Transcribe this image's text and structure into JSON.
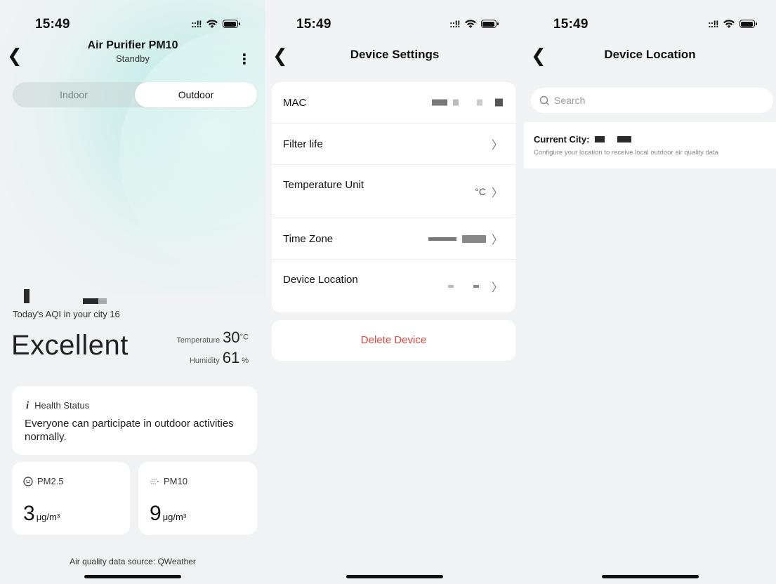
{
  "status": {
    "time": "15:49",
    "signal": "::!!"
  },
  "outdoor": {
    "title": "Air Purifier PM10",
    "subtitle": "Standby",
    "tabs": [
      {
        "label": "Indoor",
        "active": false
      },
      {
        "label": "Outdoor",
        "active": true
      }
    ],
    "aqi_caption": "Today's AQI in your city 16",
    "aqi_level": "Excellent",
    "temperature_label": "Temperature",
    "temperature_value": "30",
    "temperature_unit": "°C",
    "humidity_label": "Humidity",
    "humidity_value": "61",
    "humidity_unit": "%",
    "health_title": "Health Status",
    "health_text": "Everyone can participate in outdoor activities normally.",
    "pm25_label": "PM2.5",
    "pm25_value": "3",
    "pm10_label": "PM10",
    "pm10_value": "9",
    "unit": "μg/m³",
    "source": "Air quality data source: QWeather"
  },
  "settings": {
    "title": "Device Settings",
    "rows": [
      {
        "label": "MAC",
        "value": ""
      },
      {
        "label": "Filter life",
        "value": ""
      },
      {
        "label": "Temperature Unit",
        "value": "°C"
      },
      {
        "label": "Time Zone",
        "value": ""
      },
      {
        "label": "Device Location",
        "value": ""
      }
    ],
    "delete_label": "Delete Device"
  },
  "location": {
    "title": "Device Location",
    "search_placeholder": "Search",
    "current_city_label": "Current City:",
    "current_city_hint": "Configure your location to receive local outdoor air quality data"
  },
  "colors": {
    "accent_teal": "#bfe9e6",
    "danger": "#e8453c"
  }
}
